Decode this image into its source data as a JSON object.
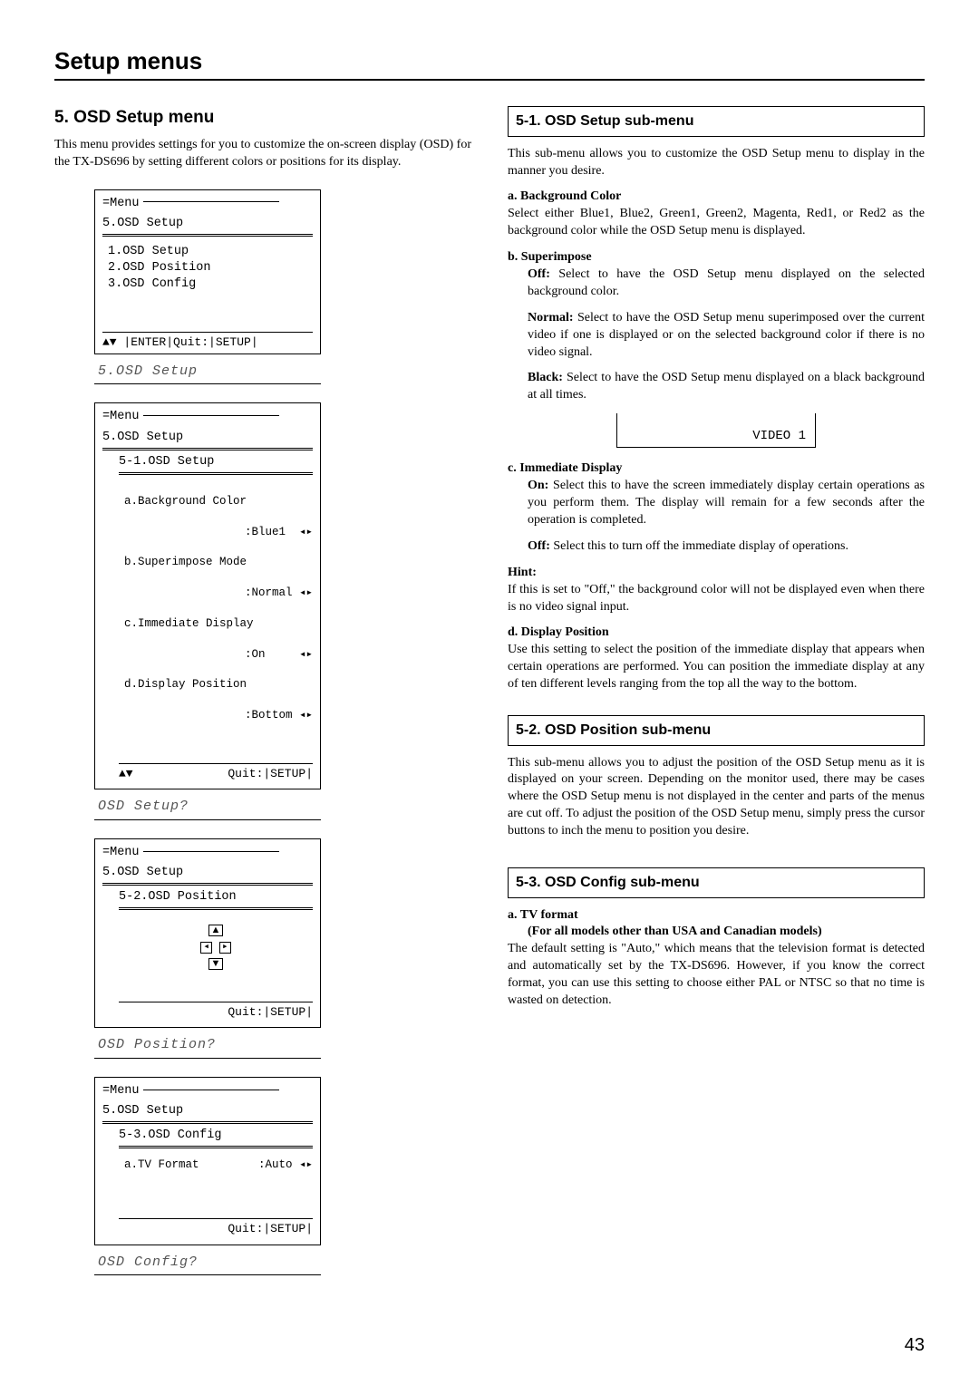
{
  "chapter_title": "Setup menus",
  "section_title": "5. OSD Setup menu",
  "section_intro": "This menu provides settings for you to customize the on-screen display (OSD) for the TX-DS696 by setting different colors or positions for its display.",
  "page_number": "43",
  "box1": {
    "menu": "Menu",
    "title": "5.OSD Setup",
    "items": [
      "1.OSD Setup",
      "2.OSD Position",
      "3.OSD Config"
    ],
    "footer_left": "▲▼ |ENTER|",
    "footer_right": "Quit:|SETUP|",
    "caption": "5.OSD Setup"
  },
  "box2": {
    "menu": "Menu",
    "title": "5.OSD Setup",
    "subtitle": "5-1.OSD Setup",
    "rows": [
      {
        "l": "a.Background Color",
        "r": ""
      },
      {
        "l": "",
        "r": ":Blue1  ◂▸"
      },
      {
        "l": "b.Superimpose Mode",
        "r": ""
      },
      {
        "l": "",
        "r": ":Normal ◂▸"
      },
      {
        "l": "c.Immediate Display",
        "r": ""
      },
      {
        "l": "",
        "r": ":On     ◂▸"
      },
      {
        "l": "d.Display Position",
        "r": ""
      },
      {
        "l": "",
        "r": ":Bottom ◂▸"
      }
    ],
    "footer_left": "▲▼",
    "footer_right": "Quit:|SETUP|",
    "caption": "OSD Setup?"
  },
  "box3": {
    "menu": "Menu",
    "title": "5.OSD Setup",
    "subtitle": "5-2.OSD Position",
    "footer_right": "Quit:|SETUP|",
    "caption": "OSD Position?"
  },
  "box4": {
    "menu": "Menu",
    "title": "5.OSD Setup",
    "subtitle": "5-3.OSD Config",
    "row_l": "a.TV Format",
    "row_r": ":Auto  ◂▸",
    "footer_right": "Quit:|SETUP|",
    "caption": "OSD Config?"
  },
  "right": {
    "sub1_title": "5-1.  OSD Setup sub-menu",
    "sub1_intro": "This sub-menu allows you to customize the OSD Setup menu to display in the manner you desire.",
    "a_head": "a. Background Color",
    "a_body": "Select either Blue1, Blue2, Green1, Green2, Magenta, Red1, or Red2 as the background color while the OSD Setup menu is displayed.",
    "b_head": "b. Superimpose",
    "b_off_l": "Off:",
    "b_off": " Select to have the OSD Setup menu displayed on the selected background color.",
    "b_norm_l": "Normal:",
    "b_norm": " Select to have the OSD Setup menu superimposed over the current video if one is displayed or on the selected background color if there is no video signal.",
    "b_black_l": "Black:",
    "b_black": " Select to have the OSD Setup menu displayed on a black background at all times.",
    "video_box": "VIDEO 1",
    "c_head": "c. Immediate Display",
    "c_on_l": "On:",
    "c_on": " Select this to have the screen immediately display certain operations as you perform them. The display will remain for a few seconds after the operation is completed.",
    "c_off_l": "Off:",
    "c_off": " Select this to turn off the immediate display of operations.",
    "hint_l": "Hint:",
    "hint": "If this is set to \"Off,\" the background color will not be displayed even when there is no video signal input.",
    "d_head": "d. Display Position",
    "d_body": "Use this setting to select the position of the immediate display that appears when certain operations are performed. You can position the immediate display at any of ten different levels ranging from the top all the way to the bottom.",
    "sub2_title": "5-2.  OSD Position sub-menu",
    "sub2_body": "This sub-menu allows you to adjust the position of the OSD Setup menu as it is displayed on your screen. Depending on the monitor used, there may be cases where the OSD Setup menu is not displayed in the center and parts of the menus are cut off. To adjust the position of the OSD Setup menu, simply press the cursor buttons to inch the menu to position you desire.",
    "sub3_title": "5-3.  OSD Config sub-menu",
    "tv_head": "a. TV format",
    "tv_sub": "(For all models other than USA and Canadian models)",
    "tv_body": "The default setting is \"Auto,\" which means that the television format is detected and automatically set by the TX-DS696. However, if you know the correct format, you can use this setting to choose either PAL or NTSC so that no time is wasted on detection."
  }
}
